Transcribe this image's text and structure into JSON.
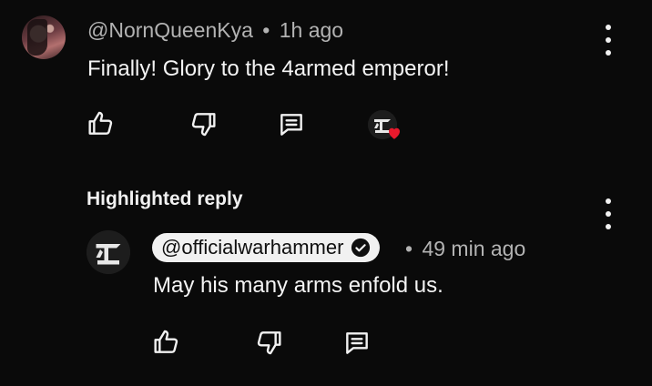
{
  "comment": {
    "author_handle": "@NornQueenKya",
    "separator": "•",
    "time": "1h ago",
    "text": "Finally! Glory to the 4armed emperor!"
  },
  "highlighted_reply": {
    "section_label": "Highlighted reply",
    "author_handle": "@officialwarhammer",
    "separator": "•",
    "time": "49 min ago",
    "text": "May his many arms enfold us."
  },
  "icons": {
    "like": "thumbs-up-icon",
    "dislike": "thumbs-down-icon",
    "reply": "comment-icon",
    "more": "more-vertical-icon",
    "creator_heart": "heart-icon",
    "verified": "verified-check-icon"
  },
  "colors": {
    "background": "#0a0a0a",
    "text_primary": "#f1f1f1",
    "text_secondary": "#b3b3b3",
    "heart": "#e8192c"
  }
}
